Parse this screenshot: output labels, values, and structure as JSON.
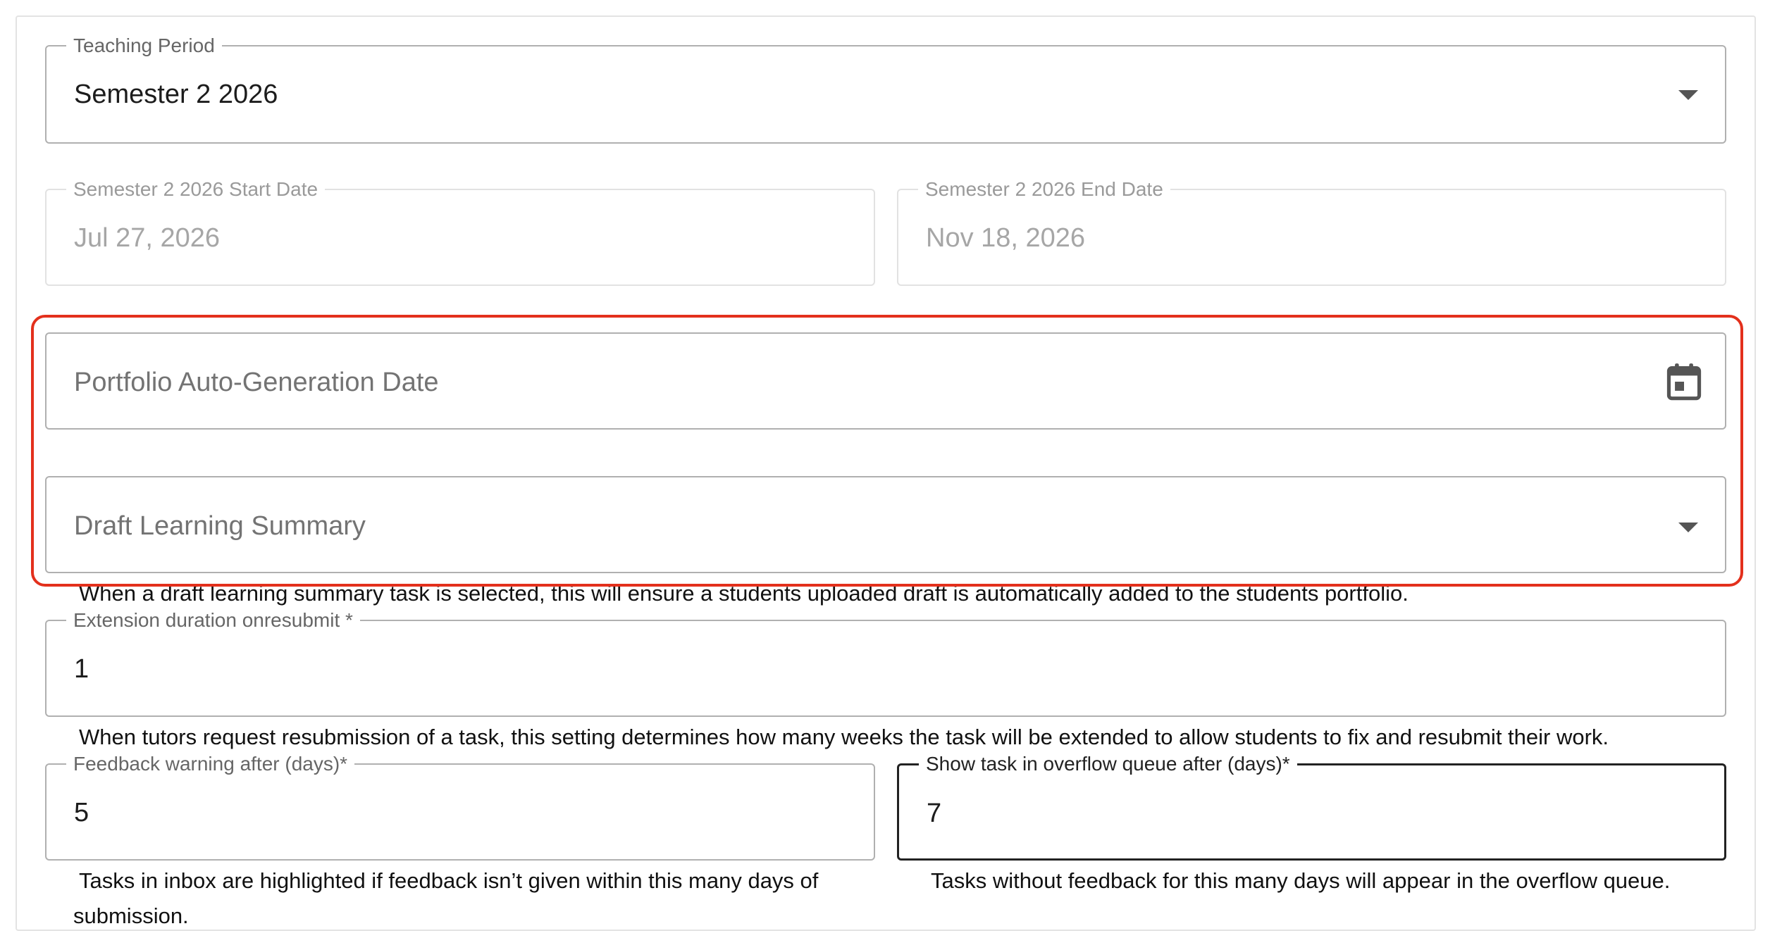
{
  "teaching_period": {
    "label": "Teaching Period",
    "value": "Semester 2 2026",
    "icon": "chevron-down-icon"
  },
  "start_date": {
    "label": "Semester 2 2026 Start Date",
    "value": "Jul 27, 2026"
  },
  "end_date": {
    "label": "Semester 2 2026 End Date",
    "value": "Nov 18, 2026"
  },
  "portfolio_date": {
    "placeholder": "Portfolio Auto-Generation Date",
    "icon": "calendar-icon"
  },
  "draft_summary": {
    "placeholder": "Draft Learning Summary",
    "hint": "When a draft learning summary task is selected, this will ensure a students uploaded draft is automatically added to the students portfolio.",
    "icon": "chevron-down-icon"
  },
  "extension_duration": {
    "label": "Extension duration onresubmit *",
    "value": "1",
    "hint": "When tutors request resubmission of a task, this setting determines how many weeks the task will be extended to allow students to fix and resubmit their work."
  },
  "feedback_warning": {
    "label": "Feedback warning after (days)*",
    "value": "5",
    "hint": "Tasks in inbox are highlighted if feedback isn’t given within this many days of submission."
  },
  "overflow_queue": {
    "label": "Show task in overflow queue after (days)*",
    "value": "7",
    "hint": "Tasks without feedback for this many days will appear in the overflow queue."
  },
  "colors": {
    "highlight": "#e3301c",
    "border": "#b0b0b0",
    "focused_border": "#222222"
  }
}
